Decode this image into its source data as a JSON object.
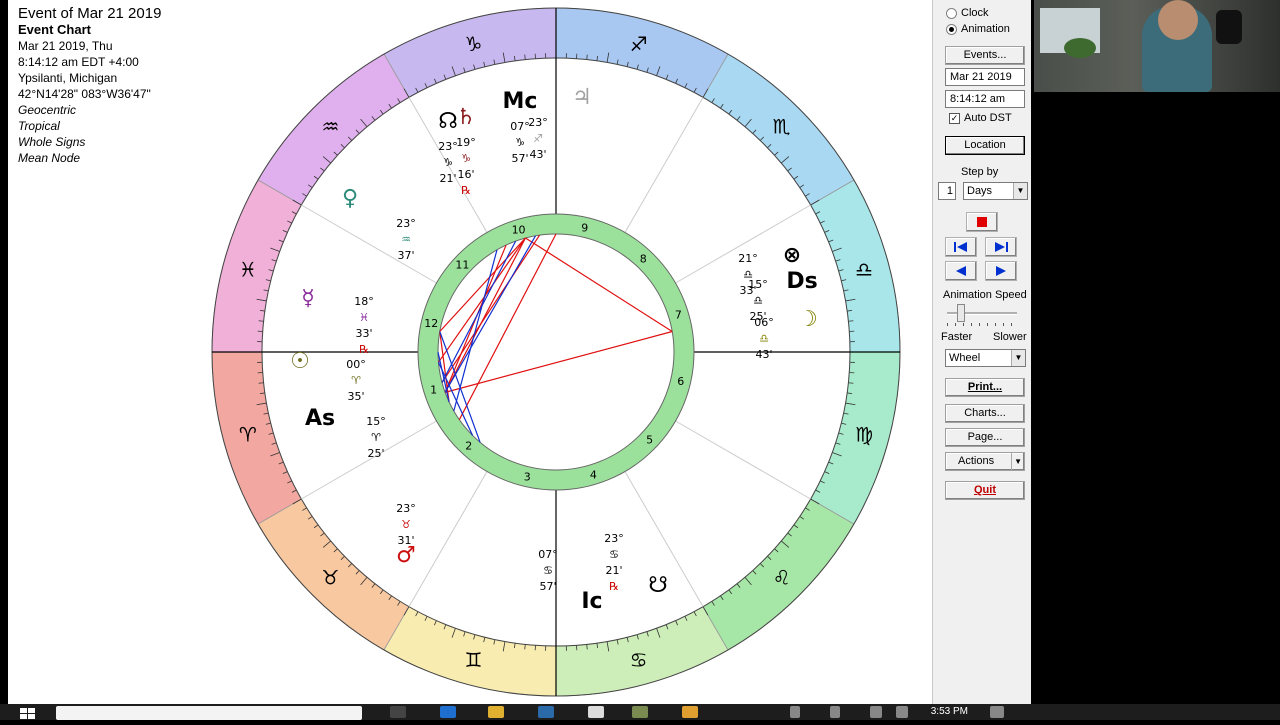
{
  "chart_info": {
    "title": "Event of Mar 21 2019",
    "subtitle": "Event Chart",
    "date_line": "Mar 21 2019, Thu",
    "time_line": "8:14:12 am  EDT +4:00",
    "location": "Ypsilanti, Michigan",
    "coords": "42°N14'28\" 083°W36'47\"",
    "options": [
      "Geocentric",
      "Tropical",
      "Whole Signs",
      "Mean Node"
    ]
  },
  "wheel": {
    "house_numbers": [
      "1",
      "2",
      "3",
      "4",
      "5",
      "6",
      "7",
      "8",
      "9",
      "10",
      "11",
      "12"
    ],
    "angles": {
      "asc": "As",
      "dsc": "Ds",
      "mc": "Mc",
      "ic": "Ic"
    },
    "placements": [
      {
        "glyph": "♄",
        "deg": "19°",
        "sign": "♑",
        "min": "16'",
        "retro": "℞",
        "color": "#8b1a1a"
      },
      {
        "glyph": "☊",
        "deg": "23°",
        "sign": "♑",
        "min": "21'",
        "color": "#000000"
      },
      {
        "glyph": "Mc",
        "deg": "07°",
        "sign": "♑",
        "min": "57'",
        "color": "#000000"
      },
      {
        "glyph": "♃",
        "deg": "23°",
        "sign": "♐",
        "min": "43'",
        "color": "#a0a0a0"
      },
      {
        "glyph": "♀",
        "deg": "23°",
        "sign": "♒",
        "min": "37'",
        "color": "#2e8b7a"
      },
      {
        "glyph": "☿",
        "deg": "18°",
        "sign": "♓",
        "min": "33'",
        "retro": "℞",
        "color": "#8a2b9a"
      },
      {
        "glyph": "☉",
        "deg": "00°",
        "sign": "♈",
        "min": "35'",
        "color": "#707020"
      },
      {
        "glyph": "As",
        "deg": "15°",
        "sign": "♈",
        "min": "25'",
        "color": "#000000"
      },
      {
        "glyph": "♂",
        "deg": "23°",
        "sign": "♉",
        "min": "31'",
        "color": "#cc1010"
      },
      {
        "glyph": "Ic",
        "deg": "07°",
        "sign": "♋",
        "min": "57'",
        "color": "#000000"
      },
      {
        "glyph": "☋",
        "deg": "23°",
        "sign": "♋",
        "min": "21'",
        "retro": "℞",
        "color": "#000000"
      },
      {
        "glyph": "⊗",
        "deg": "21°",
        "sign": "♎",
        "min": "33'",
        "color": "#000000"
      },
      {
        "glyph": "Ds",
        "deg": "15°",
        "sign": "♎",
        "min": "25'",
        "color": "#000000"
      },
      {
        "glyph": "☽",
        "deg": "06°",
        "sign": "♎",
        "min": "43'",
        "color": "#808000"
      }
    ]
  },
  "panel": {
    "radio_clock": "Clock",
    "radio_animation": "Animation",
    "events_btn": "Events...",
    "date_value": "Mar 21 2019",
    "time_value": "8:14:12 am",
    "auto_dst": "Auto DST",
    "location_btn": "Location",
    "step_by": "Step by",
    "step_value": "1",
    "step_unit": "Days",
    "anim_speed": "Animation Speed",
    "faster": "Faster",
    "slower": "Slower",
    "view_select": "Wheel",
    "print_btn": "Print...",
    "charts_btn": "Charts...",
    "page_btn": "Page...",
    "actions_btn": "Actions",
    "quit_btn": "Quit"
  },
  "taskbar": {
    "time": "3:53 PM"
  }
}
